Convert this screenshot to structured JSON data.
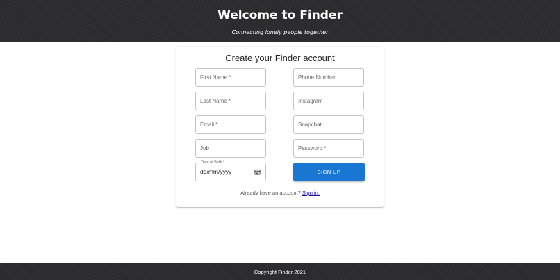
{
  "header": {
    "title": "Welcome to Finder",
    "subtitle": "Connecting lonely people together"
  },
  "form": {
    "title": "Create your Finder account",
    "required_marker": "*",
    "fields": {
      "first_name": "First Name",
      "last_name": "Last Name",
      "email": "Email",
      "job": "Job",
      "dob_label": "Date of Birth",
      "dob_value": "dd/mm/yyyy",
      "phone": "Phone Number",
      "instagram": "Instagram",
      "snapchat": "Snapchat",
      "password": "Password"
    },
    "signup_label": "SIGN UP",
    "signin_prompt": "Already have an account?",
    "signin_link": "Sign in."
  },
  "footer": {
    "copyright": "Copyright Finder 2021"
  },
  "colors": {
    "header_bg": "#2b2b2d",
    "primary": "#1976d2",
    "link": "#1a0dab"
  }
}
